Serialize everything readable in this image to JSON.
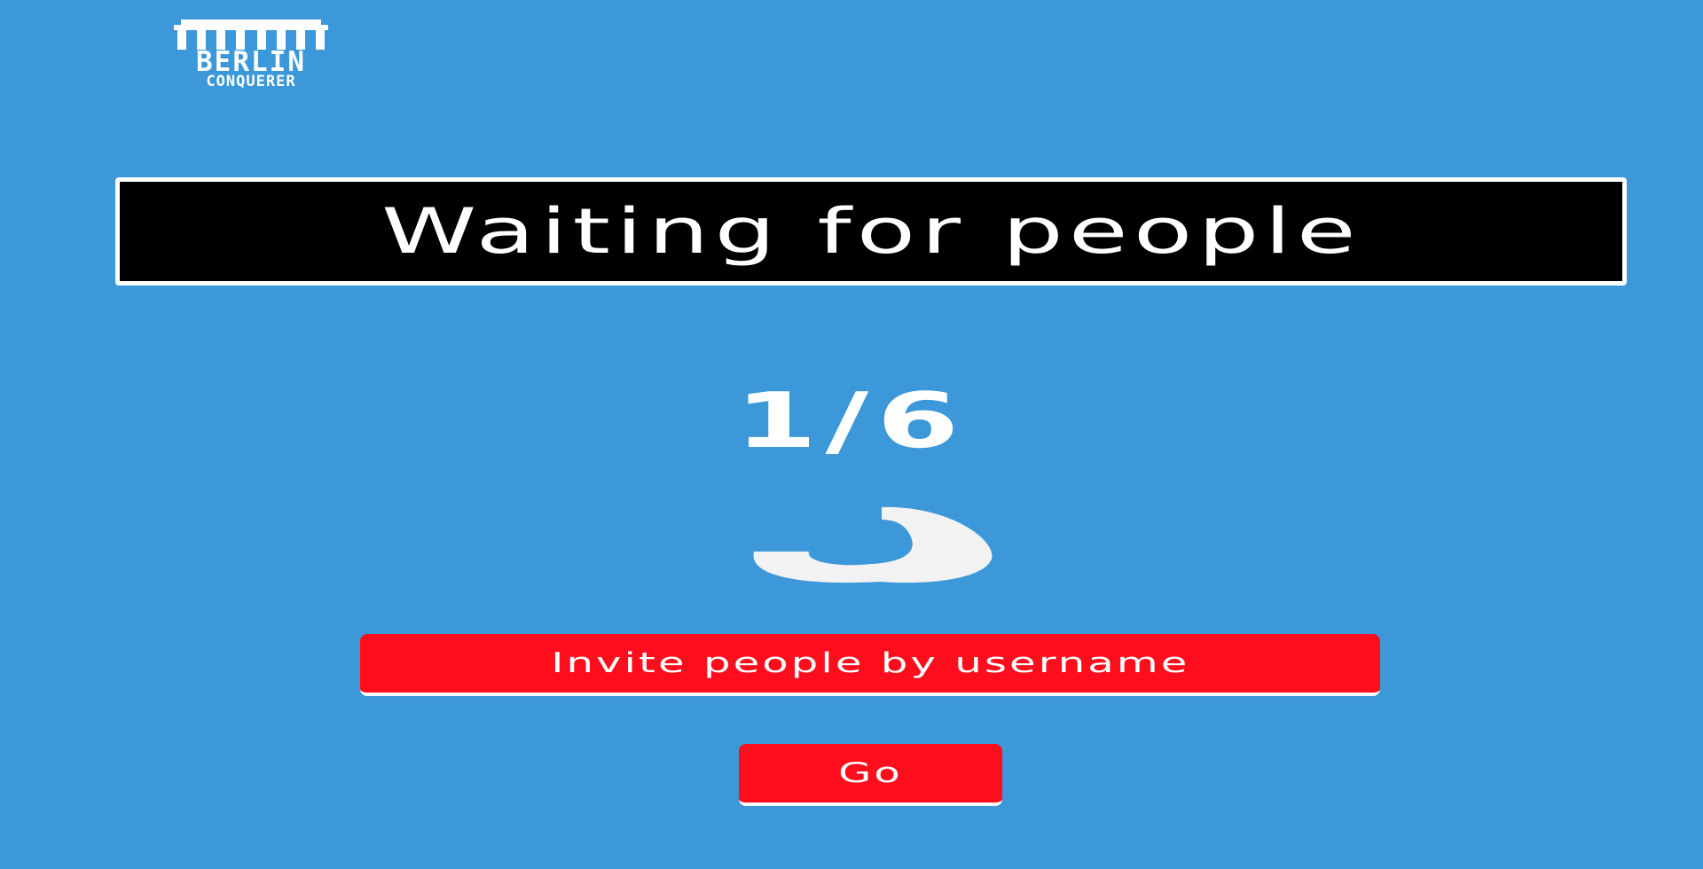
{
  "logo": {
    "line1": "BERLIN",
    "line2": "CONQUERER",
    "icon": "brandenburg-gate-icon"
  },
  "title": "Waiting for people",
  "counter": "1/6",
  "spinner": {
    "icon": "loading-spinner-icon"
  },
  "buttons": {
    "invite_label": "Invite people by username",
    "go_label": "Go"
  },
  "colors": {
    "background": "#3c98d8",
    "button": "#fe0e1d",
    "banner": "#000000",
    "text": "#ffffff"
  }
}
